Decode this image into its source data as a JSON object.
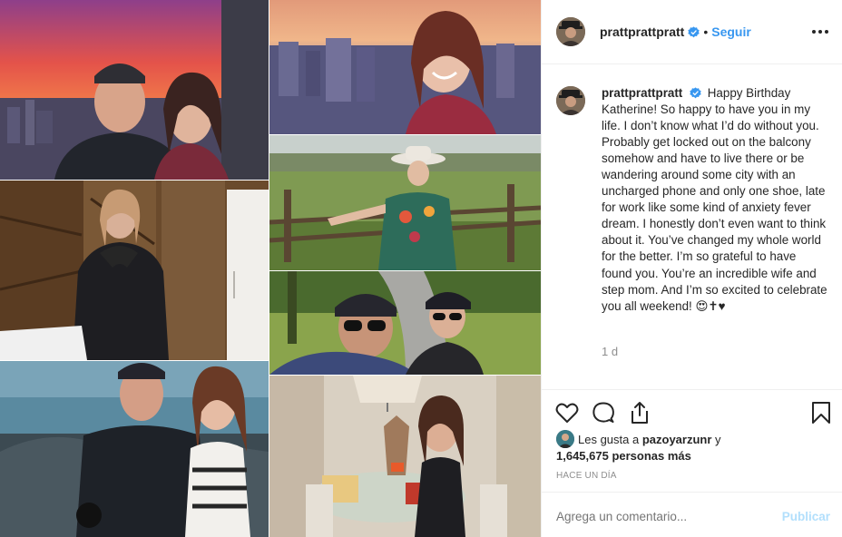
{
  "post": {
    "username": "prattprattpratt",
    "follow_label": "Seguir",
    "separator": "•",
    "caption_user": "prattprattpratt",
    "caption_text": "Happy Birthday Katherine! So happy to have you in my life. I don’t know what I’d do without you. Probably get locked out on the balcony somehow and have to live there or be wandering around some city with an uncharged phone and only one shoe, late for work like some kind of anxiety fever dream. I honestly don’t even want to think about it. You’ve changed my whole world for the better. I’m so grateful to have found you. You’re an incredible wife and step mom. And I’m so excited to celebrate you all weekend! 😍✝︎♥",
    "relative_time": "1 d",
    "likes_prefix": "Les gusta a",
    "likes_user": "pazoyarzunr",
    "likes_conjunction": "y",
    "likes_count": "1,645,675 personas más",
    "timestamp": "HACE UN DÍA",
    "comment_placeholder": "Agrega un comentario...",
    "post_label": "Publicar"
  },
  "icons": {
    "verified": "verified-badge-icon",
    "more": "more-options-icon",
    "like": "heart-icon",
    "comment": "comment-bubble-icon",
    "share": "share-icon",
    "save": "bookmark-icon"
  },
  "colors": {
    "link_blue": "#3897f0",
    "disabled_blue": "#b2dffc",
    "text": "#262626",
    "muted": "#8e8e8e",
    "border": "#efefef"
  }
}
